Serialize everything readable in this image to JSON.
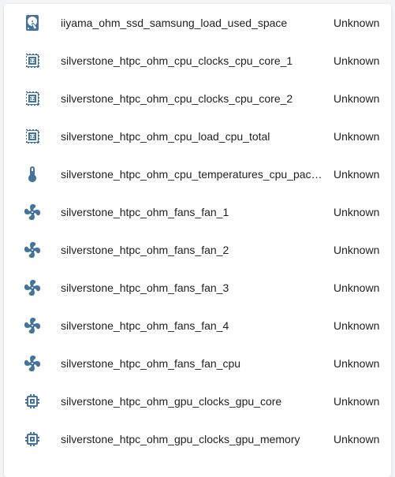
{
  "colors": {
    "icon": "#44739e",
    "text": "#212121",
    "background": "#f3f4f6",
    "card": "#ffffff"
  },
  "entities": [
    {
      "icon": "harddisk-icon",
      "name": "iiyama_ohm_ssd_samsung_load_used_space",
      "state": "Unknown"
    },
    {
      "icon": "cpu-icon",
      "name": "silverstone_htpc_ohm_cpu_clocks_cpu_core_1",
      "state": "Unknown"
    },
    {
      "icon": "cpu-icon",
      "name": "silverstone_htpc_ohm_cpu_clocks_cpu_core_2",
      "state": "Unknown"
    },
    {
      "icon": "cpu-icon",
      "name": "silverstone_htpc_ohm_cpu_load_cpu_total",
      "state": "Unknown"
    },
    {
      "icon": "thermometer-icon",
      "name": "silverstone_htpc_ohm_cpu_temperatures_cpu_package",
      "state": "Unknown"
    },
    {
      "icon": "fan-icon",
      "name": "silverstone_htpc_ohm_fans_fan_1",
      "state": "Unknown"
    },
    {
      "icon": "fan-icon",
      "name": "silverstone_htpc_ohm_fans_fan_2",
      "state": "Unknown"
    },
    {
      "icon": "fan-icon",
      "name": "silverstone_htpc_ohm_fans_fan_3",
      "state": "Unknown"
    },
    {
      "icon": "fan-icon",
      "name": "silverstone_htpc_ohm_fans_fan_4",
      "state": "Unknown"
    },
    {
      "icon": "fan-icon",
      "name": "silverstone_htpc_ohm_fans_fan_cpu",
      "state": "Unknown"
    },
    {
      "icon": "memory-icon",
      "name": "silverstone_htpc_ohm_gpu_clocks_gpu_core",
      "state": "Unknown"
    },
    {
      "icon": "memory-icon",
      "name": "silverstone_htpc_ohm_gpu_clocks_gpu_memory",
      "state": "Unknown"
    }
  ]
}
